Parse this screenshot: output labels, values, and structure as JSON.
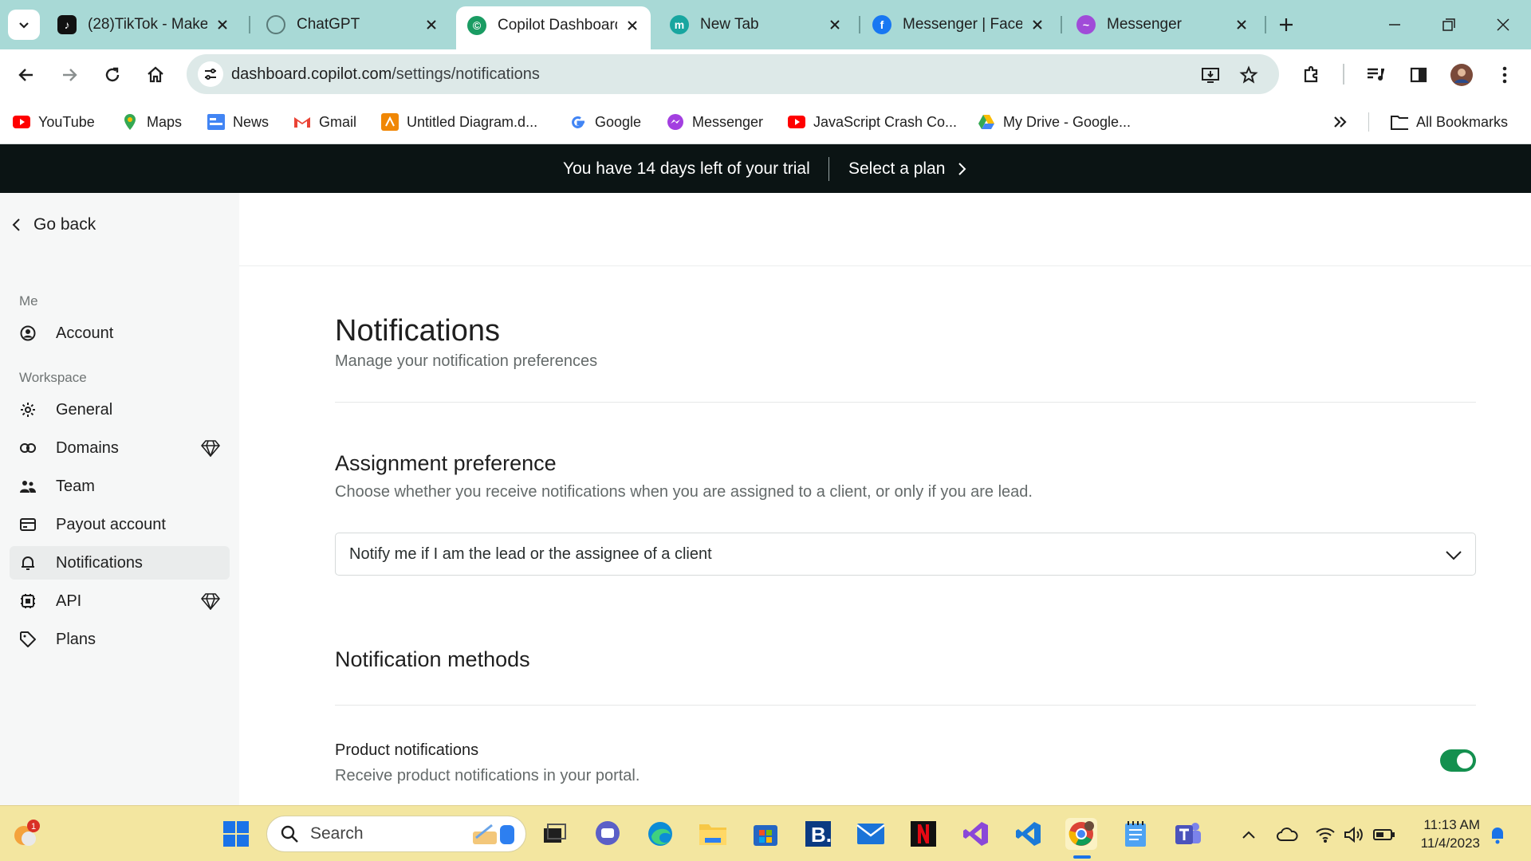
{
  "browser": {
    "tabs": [
      {
        "title": "(28)TikTok - Make",
        "icon": "tiktok-icon",
        "active": false
      },
      {
        "title": "ChatGPT",
        "icon": "chatgpt-icon",
        "active": false
      },
      {
        "title": "Copilot Dashboard",
        "icon": "copilot-icon",
        "active": true
      },
      {
        "title": "New Tab",
        "icon": "m-icon",
        "active": false
      },
      {
        "title": "Messenger | Faceb",
        "icon": "facebook-icon",
        "active": false
      },
      {
        "title": "Messenger",
        "icon": "messenger-icon",
        "active": false
      }
    ],
    "url_host": "dashboard.copilot.com",
    "url_path": "/settings/notifications",
    "bookmarks": [
      {
        "label": "YouTube",
        "icon": "youtube-icon"
      },
      {
        "label": "Maps",
        "icon": "maps-icon"
      },
      {
        "label": "News",
        "icon": "news-icon"
      },
      {
        "label": "Gmail",
        "icon": "gmail-icon"
      },
      {
        "label": "Untitled Diagram.d...",
        "icon": "drawio-icon"
      },
      {
        "label": "Google",
        "icon": "google-icon"
      },
      {
        "label": "Messenger",
        "icon": "messenger-icon"
      },
      {
        "label": "JavaScript Crash Co...",
        "icon": "youtube-icon"
      },
      {
        "label": "My Drive - Google...",
        "icon": "drive-icon"
      }
    ],
    "all_bookmarks": "All Bookmarks"
  },
  "banner": {
    "message": "You have 14 days left of your trial",
    "action": "Select a plan"
  },
  "sidebar": {
    "go_back": "Go back",
    "section_me": "Me",
    "section_workspace": "Workspace",
    "items": [
      {
        "label": "Account",
        "icon": "account-icon",
        "premium": false
      },
      {
        "label": "General",
        "icon": "gear-icon",
        "premium": false
      },
      {
        "label": "Domains",
        "icon": "link-icon",
        "premium": true
      },
      {
        "label": "Team",
        "icon": "team-icon",
        "premium": false
      },
      {
        "label": "Payout account",
        "icon": "card-icon",
        "premium": false
      },
      {
        "label": "Notifications",
        "icon": "bell-icon",
        "premium": false,
        "active": true
      },
      {
        "label": "API",
        "icon": "api-icon",
        "premium": true
      },
      {
        "label": "Plans",
        "icon": "tag-icon",
        "premium": false
      }
    ]
  },
  "page": {
    "title": "Notifications",
    "subtitle": "Manage your notification preferences",
    "assignment": {
      "title": "Assignment preference",
      "description": "Choose whether you receive notifications when you are assigned to a client, or only if you are lead.",
      "selected": "Notify me if I am the lead or the assignee of a client"
    },
    "methods": {
      "title": "Notification methods",
      "product_label": "Product notifications",
      "product_description": "Receive product notifications in your portal.",
      "product_enabled": true
    }
  },
  "taskbar": {
    "search_label": "Search",
    "time": "11:13 AM",
    "date": "11/4/2023",
    "weather_badge": "1"
  },
  "colors": {
    "tabstrip": "#a8d9d6",
    "banner": "#0b1414",
    "toggle_on": "#14904f",
    "taskbar": "#f3e6a0"
  }
}
